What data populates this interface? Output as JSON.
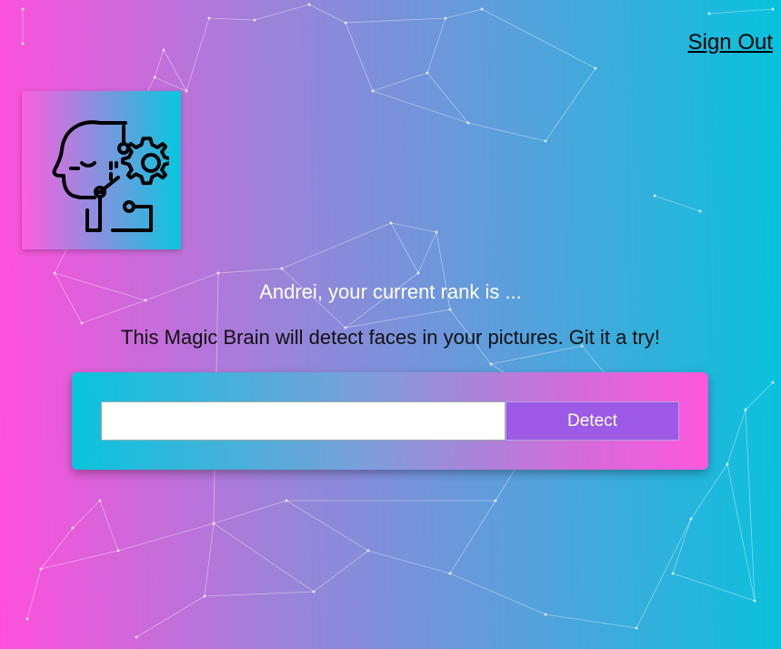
{
  "navigation": {
    "sign_out_label": "Sign Out"
  },
  "logo": {
    "icon": "brain-gear-icon",
    "gradient_start": "#ff5edf",
    "gradient_end": "#04c8de"
  },
  "rank": {
    "text": "Andrei, your current rank is ..."
  },
  "tagline": {
    "text": "This Magic Brain will detect faces in your pictures. Git it a try!"
  },
  "image_form": {
    "input_value": "",
    "input_placeholder": "",
    "detect_label": "Detect",
    "button_color": "#9c5ae6"
  },
  "background": {
    "gradient_start": "#ff4fdb",
    "gradient_end": "#08c2dc",
    "decoration": "particle-network"
  }
}
